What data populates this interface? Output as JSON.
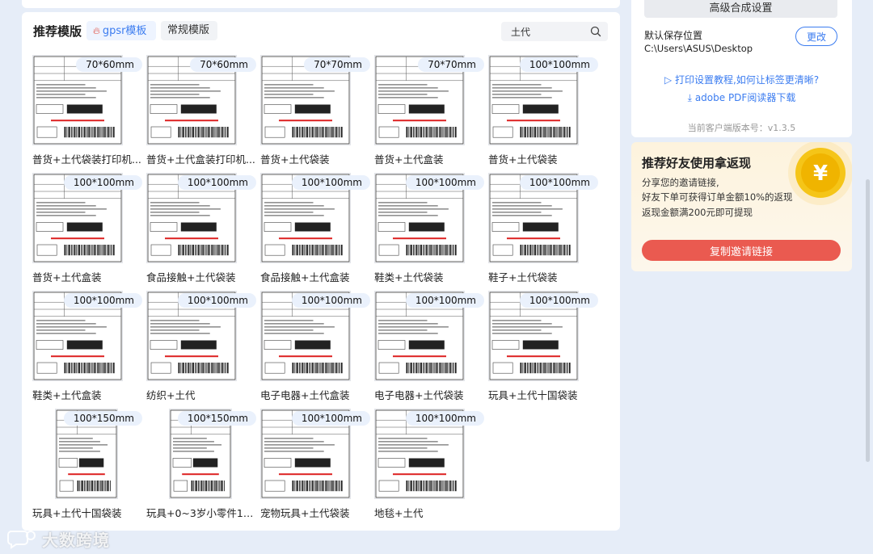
{
  "main": {
    "title": "推荐模版",
    "tabs": [
      {
        "label": "gpsr模板",
        "active": true
      },
      {
        "label": "常规模版",
        "active": false
      }
    ],
    "search": {
      "value": "土代",
      "icon": "search-icon"
    },
    "templates": [
      {
        "size": "70*60mm",
        "name": "普货+土代袋装打印机..."
      },
      {
        "size": "70*60mm",
        "name": "普货+土代盒装打印机..."
      },
      {
        "size": "70*70mm",
        "name": "普货+土代袋装"
      },
      {
        "size": "70*70mm",
        "name": "普货+土代盒装"
      },
      {
        "size": "100*100mm",
        "name": "普货+土代袋装"
      },
      {
        "size": "100*100mm",
        "name": "普货+土代盒装"
      },
      {
        "size": "100*100mm",
        "name": "食品接触+土代袋装"
      },
      {
        "size": "100*100mm",
        "name": "食品接触+土代盒装"
      },
      {
        "size": "100*100mm",
        "name": "鞋类+土代袋装"
      },
      {
        "size": "100*100mm",
        "name": "鞋子+土代袋装"
      },
      {
        "size": "100*100mm",
        "name": "鞋类+土代盒装"
      },
      {
        "size": "100*100mm",
        "name": "纺织+土代"
      },
      {
        "size": "100*100mm",
        "name": "电子电器+土代盒装"
      },
      {
        "size": "100*100mm",
        "name": "电子电器+土代袋装"
      },
      {
        "size": "100*100mm",
        "name": "玩具+土代十国袋装"
      },
      {
        "size": "100*150mm",
        "name": "玩具+土代十国袋装"
      },
      {
        "size": "100*150mm",
        "name": "玩具+0~3岁小零件1土代"
      },
      {
        "size": "100*100mm",
        "name": "宠物玩具+土代袋装"
      },
      {
        "size": "100*100mm",
        "name": "地毯+土代"
      }
    ]
  },
  "sidebar": {
    "advanced_settings": "高级合成设置",
    "save_location_label": "默认保存位置",
    "save_path": "C:\\Users\\ASUS\\Desktop",
    "change_button": "更改",
    "print_tutorial_link": "打印设置教程,如何让标签更清晰?",
    "adobe_link": "adobe PDF阅读器下载",
    "version": "当前客户端版本号：v1.3.5"
  },
  "promo": {
    "title": "推荐好友使用拿返现",
    "desc": [
      "分享您的邀请链接,",
      "好友下单可获得订单金额10%的返现",
      "返现金额满200元即可提现"
    ],
    "button": "复制邀请链接",
    "coin_glyph": "¥",
    "colors": {
      "button": "#ea5a50",
      "coin": "#f5c518"
    }
  },
  "watermark": {
    "text": "大数跨境",
    "icon": "chat-bubble-logo"
  },
  "colors": {
    "accent": "#3b7cf0",
    "background": "#e6edf8"
  }
}
